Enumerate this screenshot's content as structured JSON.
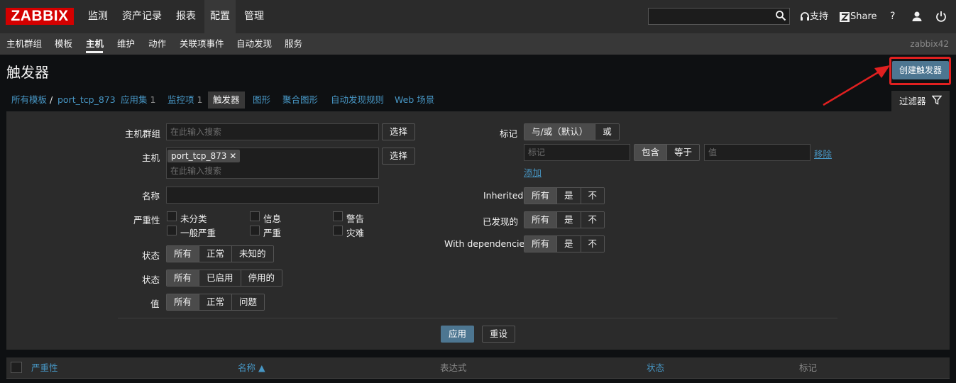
{
  "top_nav": {
    "logo": "ZABBIX",
    "items": [
      "监测",
      "资产记录",
      "报表",
      "配置",
      "管理"
    ],
    "active": "配置",
    "support": "支持",
    "share": "Share",
    "help": "?"
  },
  "sub_nav": {
    "items": [
      "主机群组",
      "模板",
      "主机",
      "维护",
      "动作",
      "关联项事件",
      "自动发现",
      "服务"
    ],
    "active": "主机",
    "server_name": "zabbix42"
  },
  "header": {
    "title": "触发器",
    "create_button": "创建触发器"
  },
  "breadcrumbs": {
    "all_templates": "所有模板",
    "separator": "/",
    "host": "port_tcp_873",
    "applications": "应用集",
    "applications_count": "1",
    "items": "监控项",
    "items_count": "1",
    "triggers": "触发器",
    "graphs": "图形",
    "screens": "聚合图形",
    "discovery": "自动发现规则",
    "web": "Web 场景"
  },
  "filter": {
    "tab_label": "过滤器",
    "host_group_label": "主机群组",
    "host_group_placeholder": "在此输入搜索",
    "select_label": "选择",
    "host_label": "主机",
    "host_tag": "port_tcp_873",
    "host_placeholder": "在此输入搜索",
    "name_label": "名称",
    "severity_label": "严重性",
    "severities": [
      "未分类",
      "信息",
      "警告",
      "一般严重",
      "严重",
      "灾难"
    ],
    "state_label": "状态",
    "state_options": [
      "所有",
      "正常",
      "未知的"
    ],
    "status_label": "状态",
    "status_options": [
      "所有",
      "已启用",
      "停用的"
    ],
    "value_label": "值",
    "value_options": [
      "所有",
      "正常",
      "问题"
    ],
    "tags_label": "标记",
    "tags_mode_options": [
      "与/或（默认）",
      "或"
    ],
    "tag_placeholder": "标记",
    "tag_operator_options": [
      "包含",
      "等于"
    ],
    "tag_value_placeholder": "值",
    "remove_label": "移除",
    "add_label": "添加",
    "inherited_label": "Inherited",
    "discovered_label": "已发现的",
    "dependencies_label": "With dependencies",
    "tri_options": [
      "所有",
      "是",
      "不"
    ],
    "apply_label": "应用",
    "reset_label": "重设"
  },
  "table": {
    "columns": [
      "严重性",
      "名称 ▲",
      "表达式",
      "状态",
      "标记"
    ]
  },
  "colors": {
    "brand_red": "#d40000",
    "accent_blue": "#4d7691",
    "link_blue": "#4796c4",
    "highlight_red": "#e02020"
  }
}
